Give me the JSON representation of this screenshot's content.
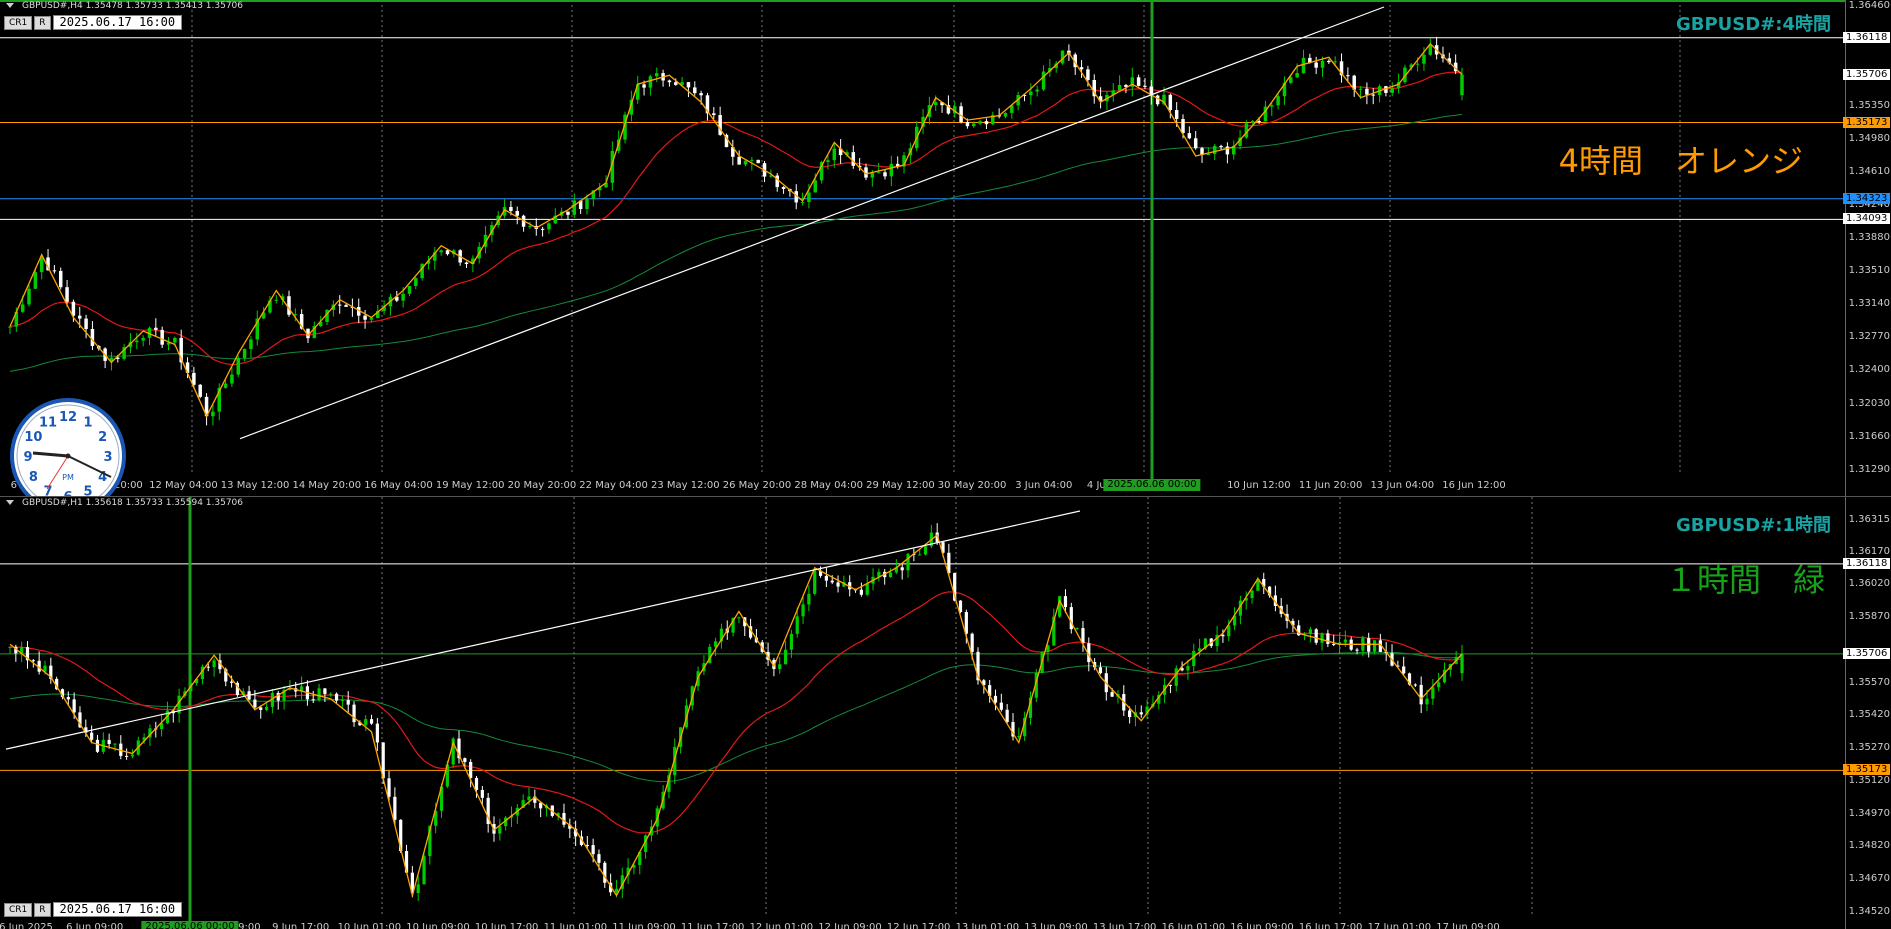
{
  "colors": {
    "bull": "#00cc00",
    "bear": "#ffffff",
    "ema_red": "#e11818",
    "ema_green": "#138a3a",
    "zigzag": "#ffa500",
    "title": "#19a3a3",
    "orange": "#ff9a00",
    "blue": "#1e90ff",
    "green_note": "#17a317",
    "vline": "#1f9d1f"
  },
  "toolbar": {
    "cr_label": "CR1",
    "r_label": "R"
  },
  "h4": {
    "ohlc": "GBPUSD#,H4  1.35478 1.35733 1.35413 1.35706",
    "title": "GBPUSD#:4時間",
    "note": "4時間　オレンジ",
    "datetime": "2025.06.17 16:00",
    "price_labels": [
      "1.36460",
      "1.35350",
      "1.34980",
      "1.34610",
      "1.34240",
      "1.33880",
      "1.33510",
      "1.33140",
      "1.32770",
      "1.32400",
      "1.32030",
      "1.31660",
      "1.31290"
    ],
    "badges": {
      "white_top": "1.36118",
      "last": "1.35706",
      "orange": "1.35173",
      "blue": "1.34323",
      "white_low": "1.34093"
    },
    "time_labels": [
      "6 May 2025",
      "8 May 20:00",
      "12 May 04:00",
      "13 May 12:00",
      "14 May 20:00",
      "16 May 04:00",
      "19 May 12:00",
      "20 May 20:00",
      "22 May 04:00",
      "23 May 12:00",
      "26 May 20:00",
      "28 May 04:00",
      "29 May 12:00",
      "30 May 20:00",
      "3 Jun 04:00",
      "4 Jun 12:00",
      "5 Jun",
      "10 Jun 12:00",
      "11 Jun 20:00",
      "13 Jun 04:00",
      "16 Jun 12:00"
    ],
    "cursor_badge": "2025.06.06 00:00"
  },
  "h1": {
    "ohlc": "GBPUSD#,H1  1.35618 1.35733 1.35594 1.35706",
    "title": "GBPUSD#:1時間",
    "note": "１時間　緑",
    "datetime": "2025.06.17 16:00",
    "price_labels": [
      "1.36315",
      "1.36170",
      "1.36020",
      "1.35870",
      "1.35570",
      "1.35420",
      "1.35270",
      "1.35120",
      "1.34970",
      "1.34820",
      "1.34670",
      "1.34520"
    ],
    "badges": {
      "white_top": "1.36118",
      "last": "1.35706",
      "orange": "1.35173"
    },
    "time_labels": [
      "6 Jun 2025",
      "6 Jun 09:00",
      "6 Jun",
      "9 Jun 09:00",
      "9 Jun 17:00",
      "10 Jun 01:00",
      "10 Jun 09:00",
      "10 Jun 17:00",
      "11 Jun 01:00",
      "11 Jun 09:00",
      "11 Jun 17:00",
      "12 Jun 01:00",
      "12 Jun 09:00",
      "12 Jun 17:00",
      "13 Jun 01:00",
      "13 Jun 09:00",
      "13 Jun 17:00",
      "16 Jun 01:00",
      "16 Jun 09:00",
      "16 Jun 17:00",
      "17 Jun 01:00",
      "17 Jun 09:00"
    ],
    "cursor_badge": "2025.06.06 00:00"
  },
  "clock": {
    "pm": "PM",
    "numbers": [
      "12",
      "1",
      "2",
      "3",
      "4",
      "5",
      "6",
      "7",
      "8",
      "9",
      "10",
      "11"
    ]
  },
  "chart_data": [
    {
      "type": "candlestick",
      "symbol": "GBPUSD#",
      "timeframe": "H4",
      "title": "GBPUSD#:4時間",
      "ylim": [
        1.3129,
        1.3646
      ],
      "last": {
        "open": 1.35478,
        "high": 1.35733,
        "low": 1.35413,
        "close": 1.35706
      },
      "close_path": [
        {
          "t": "6 May 2025",
          "c": 1.329
        },
        {
          "t": "7 May",
          "c": 1.337
        },
        {
          "t": "8 May",
          "c": 1.33
        },
        {
          "t": "8 May 20:00",
          "c": 1.325
        },
        {
          "t": "9 May",
          "c": 1.3285
        },
        {
          "t": "12 May 04:00",
          "c": 1.327
        },
        {
          "t": "12 May 20:00",
          "c": 1.319
        },
        {
          "t": "13 May 12:00",
          "c": 1.326
        },
        {
          "t": "14 May 04:00",
          "c": 1.333
        },
        {
          "t": "14 May 20:00",
          "c": 1.328
        },
        {
          "t": "15 May 12:00",
          "c": 1.332
        },
        {
          "t": "16 May 04:00",
          "c": 1.33
        },
        {
          "t": "16 May 20:00",
          "c": 1.333
        },
        {
          "t": "19 May 12:00",
          "c": 1.338
        },
        {
          "t": "20 May 04:00",
          "c": 1.336
        },
        {
          "t": "20 May 20:00",
          "c": 1.342
        },
        {
          "t": "21 May 12:00",
          "c": 1.34
        },
        {
          "t": "22 May 04:00",
          "c": 1.342
        },
        {
          "t": "22 May 20:00",
          "c": 1.345
        },
        {
          "t": "23 May 12:00",
          "c": 1.356
        },
        {
          "t": "26 May 04:00",
          "c": 1.357
        },
        {
          "t": "26 May 20:00",
          "c": 1.354
        },
        {
          "t": "27 May 12:00",
          "c": 1.348
        },
        {
          "t": "28 May 04:00",
          "c": 1.346
        },
        {
          "t": "28 May 20:00",
          "c": 1.343
        },
        {
          "t": "29 May 12:00",
          "c": 1.3495
        },
        {
          "t": "30 May 04:00",
          "c": 1.346
        },
        {
          "t": "30 May 20:00",
          "c": 1.347
        },
        {
          "t": "2 Jun 12:00",
          "c": 1.3545
        },
        {
          "t": "3 Jun 04:00",
          "c": 1.352
        },
        {
          "t": "3 Jun 20:00",
          "c": 1.3525
        },
        {
          "t": "4 Jun 12:00",
          "c": 1.3555
        },
        {
          "t": "5 Jun 04:00",
          "c": 1.3595
        },
        {
          "t": "5 Jun 20:00",
          "c": 1.354
        },
        {
          "t": "6 Jun 12:00",
          "c": 1.356
        },
        {
          "t": "9 Jun 04:00",
          "c": 1.354
        },
        {
          "t": "9 Jun 20:00",
          "c": 1.348
        },
        {
          "t": "10 Jun 12:00",
          "c": 1.349
        },
        {
          "t": "11 Jun 04:00",
          "c": 1.353
        },
        {
          "t": "11 Jun 20:00",
          "c": 1.358
        },
        {
          "t": "12 Jun 12:00",
          "c": 1.359
        },
        {
          "t": "13 Jun 04:00",
          "c": 1.3545
        },
        {
          "t": "13 Jun 20:00",
          "c": 1.356
        },
        {
          "t": "16 Jun 12:00",
          "c": 1.3605
        },
        {
          "t": "17 Jun 16:00",
          "c": 1.35706
        }
      ],
      "horizontal_lines": [
        {
          "price": 1.36118,
          "color": "white"
        },
        {
          "price": 1.35173,
          "color": "orange"
        },
        {
          "price": 1.34323,
          "color": "blue"
        },
        {
          "price": 1.34093,
          "color": "white"
        }
      ],
      "trendline": {
        "from": {
          "t": "12 May 20:00",
          "p": 1.3165
        },
        "to": {
          "t": "13 Jun 04:00",
          "p": 1.3646
        }
      },
      "moving_averages": [
        "red",
        "green"
      ],
      "zigzag": "orange"
    },
    {
      "type": "candlestick",
      "symbol": "GBPUSD#",
      "timeframe": "H1",
      "title": "GBPUSD#:1時間",
      "ylim": [
        1.3452,
        1.3636
      ],
      "last": {
        "open": 1.35618,
        "high": 1.35733,
        "low": 1.35594,
        "close": 1.35706
      },
      "close_path": [
        {
          "t": "6 Jun 2025",
          "c": 1.3575
        },
        {
          "t": "6 Jun 09:00",
          "c": 1.356
        },
        {
          "t": "6 Jun 13:00",
          "c": 1.353
        },
        {
          "t": "6 Jun 17:00",
          "c": 1.3525
        },
        {
          "t": "9 Jun 01:00",
          "c": 1.3545
        },
        {
          "t": "9 Jun 09:00",
          "c": 1.357
        },
        {
          "t": "9 Jun 13:00",
          "c": 1.3545
        },
        {
          "t": "9 Jun 17:00",
          "c": 1.3555
        },
        {
          "t": "10 Jun 01:00",
          "c": 1.355
        },
        {
          "t": "10 Jun 05:00",
          "c": 1.3535
        },
        {
          "t": "10 Jun 09:00",
          "c": 1.346
        },
        {
          "t": "10 Jun 13:00",
          "c": 1.353
        },
        {
          "t": "10 Jun 17:00",
          "c": 1.349
        },
        {
          "t": "11 Jun 01:00",
          "c": 1.3505
        },
        {
          "t": "11 Jun 05:00",
          "c": 1.349
        },
        {
          "t": "11 Jun 09:00",
          "c": 1.346
        },
        {
          "t": "11 Jun 13:00",
          "c": 1.3495
        },
        {
          "t": "11 Jun 17:00",
          "c": 1.356
        },
        {
          "t": "12 Jun 01:00",
          "c": 1.359
        },
        {
          "t": "12 Jun 05:00",
          "c": 1.3565
        },
        {
          "t": "12 Jun 09:00",
          "c": 1.361
        },
        {
          "t": "12 Jun 13:00",
          "c": 1.36
        },
        {
          "t": "12 Jun 17:00",
          "c": 1.361
        },
        {
          "t": "13 Jun 01:00",
          "c": 1.3625
        },
        {
          "t": "13 Jun 05:00",
          "c": 1.356
        },
        {
          "t": "13 Jun 09:00",
          "c": 1.353
        },
        {
          "t": "13 Jun 13:00",
          "c": 1.3595
        },
        {
          "t": "13 Jun 17:00",
          "c": 1.356
        },
        {
          "t": "16 Jun 01:00",
          "c": 1.354
        },
        {
          "t": "16 Jun 05:00",
          "c": 1.3565
        },
        {
          "t": "16 Jun 09:00",
          "c": 1.358
        },
        {
          "t": "16 Jun 13:00",
          "c": 1.3605
        },
        {
          "t": "16 Jun 17:00",
          "c": 1.358
        },
        {
          "t": "17 Jun 01:00",
          "c": 1.3575
        },
        {
          "t": "17 Jun 05:00",
          "c": 1.3575
        },
        {
          "t": "17 Jun 09:00",
          "c": 1.355
        },
        {
          "t": "17 Jun 16:00",
          "c": 1.35706
        }
      ],
      "horizontal_lines": [
        {
          "price": 1.36118,
          "color": "white"
        },
        {
          "price": 1.35706,
          "color": "green"
        },
        {
          "price": 1.35173,
          "color": "orange"
        }
      ],
      "trendline": {
        "from": {
          "t": "6 Jun 2025",
          "p": 1.3527
        },
        "to": {
          "t": "13 Jun 05:00",
          "p": 1.3636
        }
      },
      "moving_averages": [
        "red",
        "green"
      ],
      "zigzag": "orange"
    }
  ]
}
